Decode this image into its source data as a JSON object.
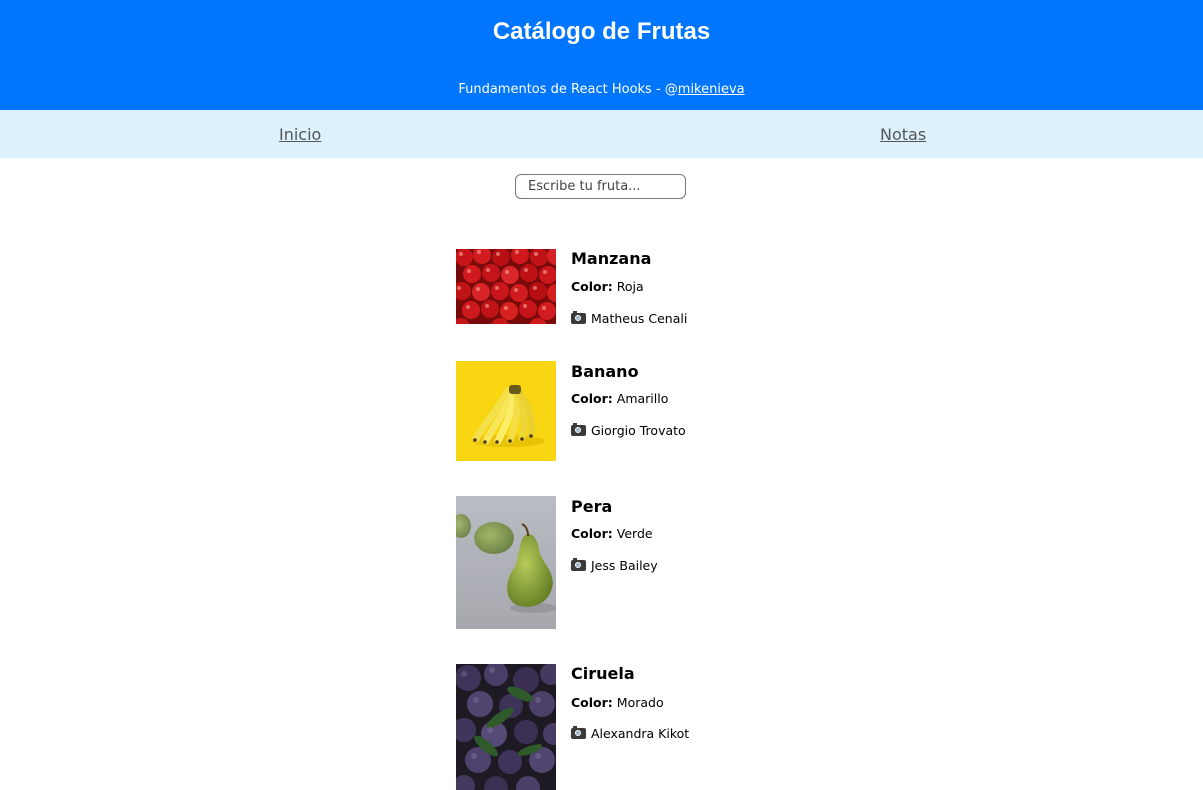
{
  "header": {
    "title": "Catálogo de Frutas",
    "subtitle_prefix": "Fundamentos de React Hooks - @",
    "author_link": "mikenieva"
  },
  "nav": {
    "home": "Inicio",
    "notes": "Notas"
  },
  "search": {
    "placeholder": "Escribe tu fruta..."
  },
  "labels": {
    "color": "Color:"
  },
  "fruits": [
    {
      "name": "Manzana",
      "color": "Roja",
      "credit": "Matheus Cenali",
      "icon": "camera-with-flash-icon"
    },
    {
      "name": "Banano",
      "color": "Amarillo",
      "credit": "Giorgio Trovato",
      "icon": "camera-with-flash-icon"
    },
    {
      "name": "Pera",
      "color": "Verde",
      "credit": "Jess Bailey",
      "icon": "camera-with-flash-icon"
    },
    {
      "name": "Ciruela",
      "color": "Morado",
      "credit": "Alexandra Kikot",
      "icon": "camera-with-flash-icon"
    }
  ],
  "colors": {
    "header_bg": "#0076ff",
    "nav_bg": "#ddf1fe",
    "nav_link": "#555555"
  }
}
